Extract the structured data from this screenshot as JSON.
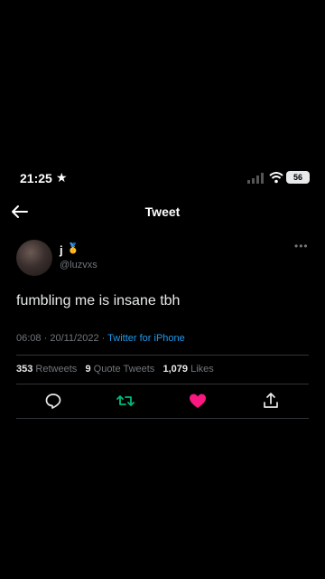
{
  "status_bar": {
    "time": "21:25",
    "star": "★",
    "battery": "56"
  },
  "nav": {
    "title": "Tweet"
  },
  "tweet": {
    "author_name": "j",
    "author_emoji": "🥇",
    "handle": "@luzvxs",
    "text": "fumbling me is insane tbh",
    "time": "06:08",
    "date": "20/11/2022",
    "source": "Twitter for iPhone",
    "retweets": "353",
    "retweets_label": "Retweets",
    "quote_tweets": "9",
    "quote_tweets_label": "Quote Tweets",
    "likes": "1,079",
    "likes_label": "Likes"
  },
  "colors": {
    "background": "#000000",
    "link": "#1d9bf0",
    "retweet": "#00ba7c",
    "like": "#f91880",
    "muted": "#71767b"
  },
  "icons": [
    "back-arrow-icon",
    "more-icon",
    "reply-icon",
    "retweet-icon",
    "like-heart-icon",
    "share-icon"
  ]
}
